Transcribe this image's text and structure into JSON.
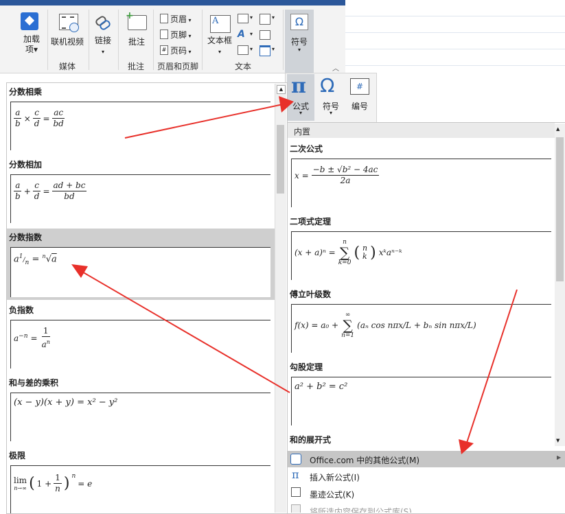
{
  "ribbon": {
    "buttons": {
      "addins": "加载\n项▾",
      "online_video": "联机视频",
      "link": "链接",
      "comment": "批注",
      "header": "页眉",
      "footer": "页脚",
      "page_number": "页码",
      "textbox": "文本框",
      "symbol": "符号"
    },
    "groups": {
      "media": "媒体",
      "comments": "批注",
      "header_footer": "页眉和页脚",
      "text": "文本"
    }
  },
  "symbol_strip": {
    "equation": "公式",
    "symbol": "符号",
    "number": "编号"
  },
  "left_gallery": {
    "items": [
      {
        "label": "分数相乘"
      },
      {
        "label": "分数相加"
      },
      {
        "label": "分数指数"
      },
      {
        "label": "负指数"
      },
      {
        "label": "和与差的乘积"
      },
      {
        "label": "极限"
      }
    ],
    "eq": {
      "prod_rhs1": "ac",
      "prod_rhs2": "bd",
      "sum_rhs1": "ad + bc",
      "sum_rhs2": "bd",
      "prod": "(x − y)(x + y) = x² − y²",
      "lim_text": "lim",
      "lim_sub": "n→∞",
      "lim_eq": "= e"
    }
  },
  "right_gallery": {
    "section": "内置",
    "items": [
      {
        "label": "二次公式"
      },
      {
        "label": "二项式定理"
      },
      {
        "label": "傅立叶级数"
      },
      {
        "label": "勾股定理"
      },
      {
        "label": "和的展开式"
      }
    ],
    "eq": {
      "quad_lhs": "x =",
      "quad_num": "−b ± √b² − 4ac",
      "quad_den": "2a",
      "binom_lhs": "(x + a)ⁿ =",
      "binom_rhs": "xᵏaⁿ⁻ᵏ",
      "fourier_lhs": "f(x) = a₀ +",
      "fourier_rhs": "(aₙ cos nπx/L + bₙ sin nπx/L)",
      "pyth": "a² + b² = c²"
    }
  },
  "menu": {
    "office_more": "Office.com 中的其他公式(M)",
    "insert_new": "插入新公式(I)",
    "ink": "墨迹公式(K)",
    "save_sel": "将所选内容保存到公式库(S)..."
  },
  "colors": {
    "arrow": "#e8302a",
    "ribbon_blue": "#2b579a",
    "accent_blue": "#2e6bb8"
  }
}
